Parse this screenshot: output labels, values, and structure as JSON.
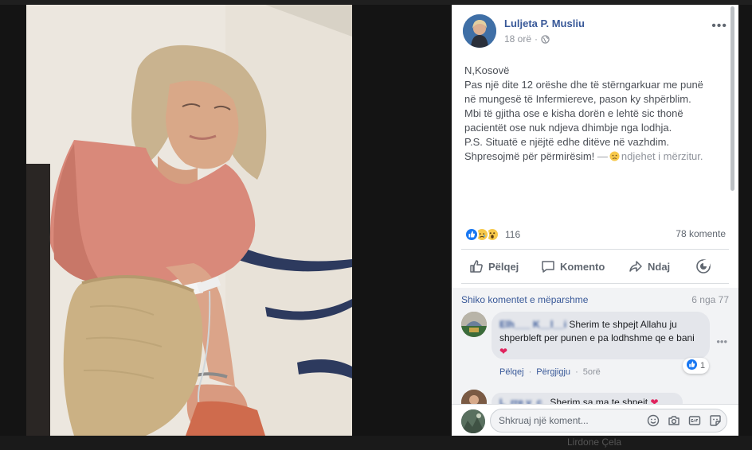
{
  "post": {
    "author": "Luljeta P. Musliu",
    "time": "18 orë",
    "lines": [
      "N,Kosovë",
      "Pas një dite 12 orëshe dhe të stërngarkuar me punë",
      "në mungesë të Infermiereve, pason ky shpërblim.",
      "Mbi të gjitha ose e kisha dorën e lehtë sic thonë",
      "pacientët ose nuk ndjeva dhimbje nga lodhja.",
      "P.S. Situatë e njëjtë edhe ditëve në vazhdim."
    ],
    "last_line": "Shpresojmë për përmirësim!",
    "feeling_dash": "—",
    "feeling_text": "ndjehet i mërzitur."
  },
  "stats": {
    "reactions_count": "116",
    "comments_count": "78 komente"
  },
  "actions": {
    "like": "Pëlqej",
    "comment": "Komento",
    "share": "Ndaj"
  },
  "comments": {
    "previous_link": "Shiko komentet e mëparshme",
    "page_count": "6 nga 77",
    "first": {
      "name": "Elh___ K__l__i",
      "text": "Sherim te shpejt Allahu ju shperbleft per punen e pa lodhshme qe e bani",
      "likes": "1",
      "like_link": "Pëlqej",
      "reply_link": "Përgjigju",
      "time": "5orë"
    },
    "second": {
      "name": "L_rre v_c_",
      "text": "Sherim sa ma te shpejt"
    }
  },
  "input": {
    "placeholder": "Shkruaj një koment..."
  },
  "backdrop_text": "Lirdone Çela",
  "colors": {
    "link": "#385898",
    "like_blue": "#1877f2",
    "heart": "#e0245e"
  },
  "icons": [
    "globe-icon",
    "more-dots-icon",
    "like-reaction-icon",
    "sad-reaction-icon",
    "wow-reaction-icon",
    "thumb-icon",
    "comment-icon",
    "share-icon",
    "avatar-picker-icon",
    "emoji-icon",
    "camera-icon",
    "gif-icon",
    "sticker-icon"
  ]
}
